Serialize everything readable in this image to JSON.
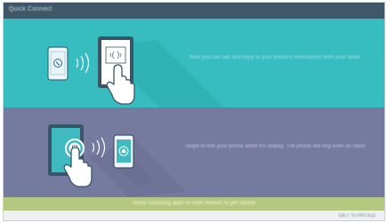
{
  "window": {
    "title": "Quick Connect"
  },
  "panels": [
    {
      "name": "phone-to-tablet",
      "description": "Now you can see and reply to your phone's notifications from your tablet",
      "color": "#37bcbf"
    },
    {
      "name": "tablet-to-phone",
      "description": "Swipe to find your phone when it's nearby. The phone will ring even on silent",
      "color": "#757a9f"
    }
  ],
  "band": {
    "text": "Install Samsung apps on both devices to get started",
    "color": "#b6c87f"
  },
  "footer": {
    "action_label": "GET STARTED"
  },
  "icons": {
    "phone_call": "phone-icon",
    "nfc_waves": "signal-waves-icon",
    "tap_hand": "hand-pointer-icon",
    "alarm_bell": "bell-icon"
  }
}
